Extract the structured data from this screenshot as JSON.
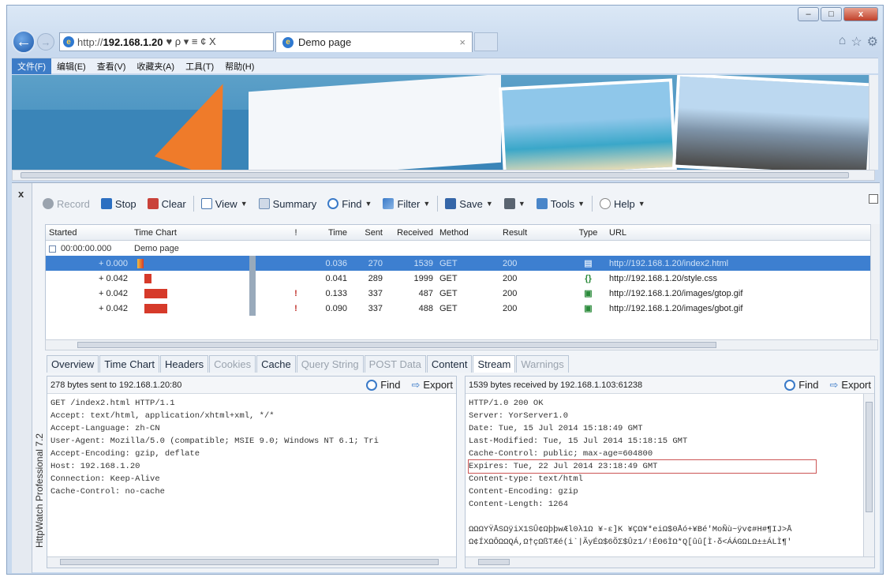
{
  "browser": {
    "address_prefix": "http://",
    "address_host": "192.168.1.20",
    "address_tail": "♥ ρ ▾ ≡ ¢ X",
    "tab_title": "Demo page",
    "tab_close": "×",
    "window_minimize": "–",
    "window_maximize": "□",
    "window_close": "x",
    "right_icons": [
      "home-icon",
      "star-icon",
      "gear-icon"
    ]
  },
  "menu": [
    "文件(F)",
    "编辑(E)",
    "查看(V)",
    "收藏夹(A)",
    "工具(T)",
    "帮助(H)"
  ],
  "httpwatch": {
    "product_label": "HttpWatch Professional 7.2",
    "close": "x",
    "toolbar": {
      "record": "Record",
      "stop": "Stop",
      "clear": "Clear",
      "view": "View",
      "summary": "Summary",
      "find": "Find",
      "filter": "Filter",
      "save": "Save",
      "tools": "Tools",
      "help": "Help"
    },
    "columns": [
      "Started",
      "Time Chart",
      "!",
      "Time",
      "Sent",
      "Received",
      "Method",
      "Result",
      "Type",
      "URL"
    ],
    "group": {
      "started": "00:00:00.000",
      "label": "Demo page"
    },
    "rows": [
      {
        "started": "+ 0.000",
        "warn": "",
        "time": "0.036",
        "sent": "270",
        "received": "1539",
        "method": "GET",
        "result": "200",
        "type": "page-icon",
        "url": "http://192.168.1.20/index2.html",
        "bar_start": 0.0,
        "bar_len": 0.04,
        "selected": true
      },
      {
        "started": "+ 0.042",
        "warn": "",
        "time": "0.041",
        "sent": "289",
        "received": "1999",
        "method": "GET",
        "result": "200",
        "type": "css-icon",
        "url": "http://192.168.1.20/style.css",
        "bar_start": 0.05,
        "bar_len": 0.05,
        "selected": false
      },
      {
        "started": "+ 0.042",
        "warn": "!",
        "time": "0.133",
        "sent": "337",
        "received": "487",
        "method": "GET",
        "result": "200",
        "type": "image-icon",
        "url": "http://192.168.1.20/images/gtop.gif",
        "bar_start": 0.05,
        "bar_len": 0.16,
        "selected": false
      },
      {
        "started": "+ 0.042",
        "warn": "!",
        "time": "0.090",
        "sent": "337",
        "received": "488",
        "method": "GET",
        "result": "200",
        "type": "image-icon",
        "url": "http://192.168.1.20/images/gbot.gif",
        "bar_start": 0.05,
        "bar_len": 0.16,
        "selected": false
      }
    ],
    "tabs": [
      "Overview",
      "Time Chart",
      "Headers",
      "Cookies",
      "Cache",
      "Query String",
      "POST Data",
      "Content",
      "Stream",
      "Warnings"
    ],
    "disabled_tabs": [
      "Cookies",
      "Query String",
      "POST Data",
      "Warnings"
    ],
    "active_tab": "Stream",
    "left_pane": {
      "status": "278 bytes sent to 192.168.1.20:80",
      "find": "Find",
      "export": "Export",
      "lines": [
        "GET /index2.html HTTP/1.1",
        "Accept: text/html, application/xhtml+xml, */*",
        "Accept-Language: zh-CN",
        "User-Agent: Mozilla/5.0 (compatible; MSIE 9.0; Windows NT 6.1; Tri",
        "Accept-Encoding: gzip, deflate",
        "Host: 192.168.1.20",
        "Connection: Keep-Alive",
        "Cache-Control: no-cache"
      ]
    },
    "right_pane": {
      "status": "1539 bytes received by 192.168.1.103:61238",
      "find": "Find",
      "export": "Export",
      "lines": [
        "HTTP/1.0 200 OK",
        "Server: YorServer1.0",
        "Date: Tue, 15 Jul 2014 15:18:49 GMT",
        "Last-Modified: Tue, 15 Jul 2014 15:18:15 GMT",
        "Cache-Control: public; max-age=604800",
        "Expires: Tue, 22 Jul 2014 23:18:49 GMT",
        "Content-type: text/html",
        "Content-Encoding: gzip",
        "Content-Length: 1264",
        "",
        "ΩΩΩΥΫÅSΩÿiX1SÛ¢ΩþþwÆl0λ1Ω ¥-ε]K ¥ÇΩ¥*eiΩ$0Åó+¥Bé'MoÑù~ÿv¢#H#¶IJ>Å",
        "Ω¢ÍXΩÔΩΩQÁ,Ω†çΩßTÆé(i`|ÃyÉΩ$6ÕΣ$Ûz1/!ÉΘ6ÌΩ*Q[ûû[Ì·δ<ÁÁGΩLΩ±±ÁLÌ¶'"
      ],
      "highlight_index": 5
    }
  }
}
